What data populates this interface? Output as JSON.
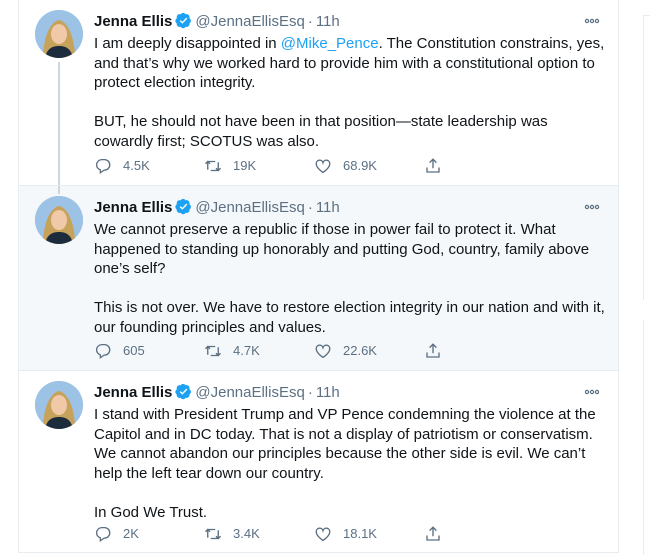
{
  "tweets": [
    {
      "name": "Jenna Ellis",
      "handle": "@JennaEllisEsq",
      "dot": "·",
      "time": "11h",
      "text_before": "I am deeply disappointed in ",
      "mention": "@Mike_Pence",
      "text_after": ". The Constitution constrains, yes, and that’s why we worked hard to provide him with a constitutional option to protect election integrity.\n\nBUT, he should not have been in that position—state leadership was cowardly first; SCOTUS was also.",
      "replies": "4.5K",
      "retweets": "19K",
      "likes": "68.9K"
    },
    {
      "name": "Jenna Ellis",
      "handle": "@JennaEllisEsq",
      "dot": "·",
      "time": "11h",
      "text": "We cannot preserve a republic if those in power fail to protect it. What happened to standing up honorably and putting God, country, family above one’s self?\n\nThis is not over. We have to restore election integrity in our nation and with it, our founding principles and values.",
      "replies": "605",
      "retweets": "4.7K",
      "likes": "22.6K"
    },
    {
      "name": "Jenna Ellis",
      "handle": "@JennaEllisEsq",
      "dot": "·",
      "time": "11h",
      "text": "I stand with President Trump and VP Pence condemning the violence at the Capitol and in DC today. That is not a display of patriotism or conservatism. We cannot abandon our principles because the other side is evil. We can’t help the left tear down our country.\n\nIn God We Trust.",
      "replies": "2K",
      "retweets": "3.4K",
      "likes": "18.1K"
    }
  ],
  "icons": {
    "verified": "verified-badge-icon",
    "more": "more-options-icon",
    "reply": "reply-icon",
    "retweet": "retweet-icon",
    "like": "heart-icon",
    "share": "share-icon"
  },
  "colors": {
    "accent": "#1da1f2",
    "secondary_text": "#5b7083",
    "highlight_bg": "#f5f8fa"
  }
}
